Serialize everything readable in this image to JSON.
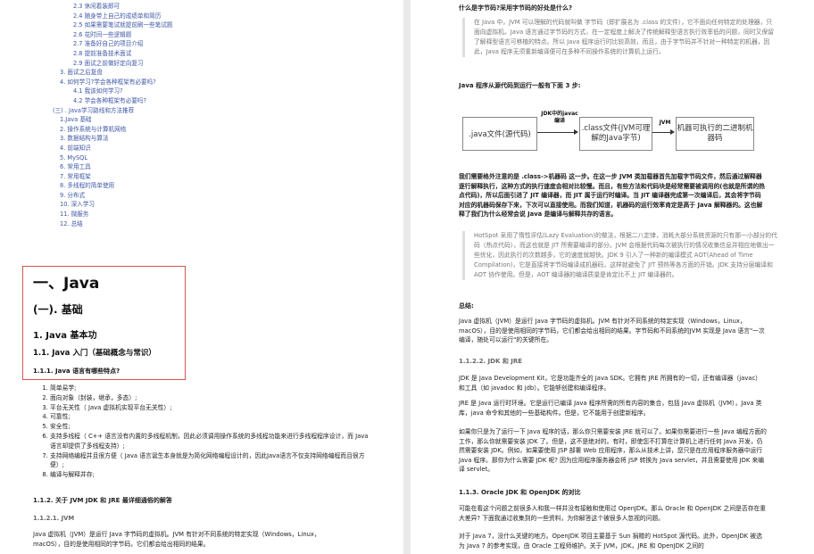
{
  "toc": [
    {
      "level": "l3",
      "text": "2.3 休闲着装即可"
    },
    {
      "level": "l3",
      "text": "2.4 随身带上自己的成绩单和简历"
    },
    {
      "level": "l3",
      "text": "2.5 如果需要笔试就提前刷一些笔试题"
    },
    {
      "level": "l3",
      "text": "2.6 花时间一些逻辑题"
    },
    {
      "level": "l3",
      "text": "2.7 准备好自己的项目介绍"
    },
    {
      "level": "l3",
      "text": "2.8 提前准备技术面试"
    },
    {
      "level": "l3",
      "text": "2.9 面试之前做好定向复习"
    },
    {
      "level": "l2",
      "text": "3. 面试之后复盘"
    },
    {
      "level": "l2",
      "text": "4. 如何学习?学会各种框架有必要吗?"
    },
    {
      "level": "l4",
      "text": "4.1 我该如何学习?"
    },
    {
      "level": "l4",
      "text": "4.2 学会各种框架有必要吗?"
    },
    {
      "level": "l2b",
      "text": "(三) . Java学习路线和方法推荐"
    },
    {
      "level": "l2",
      "text": "1.Java 基础"
    },
    {
      "level": "l2",
      "text": "2. 操作系统与计算机网络"
    },
    {
      "level": "l2",
      "text": "3. 数据结构与算法"
    },
    {
      "level": "l2",
      "text": "4. 前端知识"
    },
    {
      "level": "l2",
      "text": "5. MySQL"
    },
    {
      "level": "l2",
      "text": "6. 常用工具"
    },
    {
      "level": "l2",
      "text": "7. 常用框架"
    },
    {
      "level": "l2",
      "text": "8. 多线程的简单使用"
    },
    {
      "level": "l2",
      "text": "9. 分布式"
    },
    {
      "level": "l2",
      "text": "10. 深入学习"
    },
    {
      "level": "l2",
      "text": "11. 微服务"
    },
    {
      "level": "l2",
      "text": "12. 总结"
    }
  ],
  "left": {
    "h1": "一、Java",
    "h2": "(一). 基础",
    "h3": "1. Java 基本功",
    "h4": "1.1. Java 入门（基础概念与常识）",
    "h5": "1.1.1. Java 语言有哪些特点?",
    "features": [
      "简单易学;",
      "面向对象（封装，继承，多态）;",
      "平台无关性（ Java 虚拟机实现平台无关性）;",
      "可靠性;",
      "安全性;",
      "支持多线程（ C++ 语言没有内置的多线程机制，因此必须调用操作系统的多线程功能来进行多线程程序设计，而 Java 语言却提供了多线程支持）;",
      "支持网络编程并且很方便（ Java 语言诞生本身就是为简化网络编程设计的，因此Java语言不仅支持网络编程而且很方便）;",
      "编译与解释并存;"
    ],
    "sub1": "1.1.2. 关于 JVM JDK 和 JRE 最详细通俗的解答",
    "sub2": "1.1.2.1. JVM",
    "para": "Java 虚拟机（JVM）是运行 Java 字节码的虚拟机。JVM 有针对不同系统的特定实现（Windows，Linux，macOS），目的是使用相同的字节码，它们都会给出相同的结果。"
  },
  "right": {
    "q1": "什么是字节码?采用字节码的好处是什么?",
    "quote1": "在 Java 中，JVM 可以理解的代码就叫做 字节码（即扩展名为 .class 的文件），它不面向任何特定的处理器，只面向虚拟机。Java 语言通过字节码的方式，在一定程度上解决了传统解释型语言执行效率低的问题，同时又保留了解释型语言可移植的特点。所以 Java 程序运行时比较高效，而且，由于字节码并不针对一种特定的机器，因此，Java 程序无须重新编译便可在多种不同操作系统的计算机上运行。",
    "q2": "Java 程序从源代码到运行一般有下面 3 步:",
    "flow": {
      "box1": ".java文件(源代码)",
      "label1": "JDK中的javac编译",
      "box2": ".class文件(JVM可理解的Java字节)",
      "label2": "JVM",
      "box3": "机器可执行的二进制机器码"
    },
    "para1": "我们需要格外注意的是 .class->机器码 这一步。在这一步 JVM 类加载器首先加载字节码文件，然后通过解释器逐行解释执行，这种方式的执行速度会相对比较慢。而且，有些方法和代码块是经常需要被调用的(也就是所谓的热点代码)，所以后面引进了 JIT 编译器，而 JIT 属于运行时编译。当 JIT 编译器完成第一次编译后，其会将字节码对应的机器码保存下来，下次可以直接使用。而我们知道，机器码的运行效率肯定是高于 Java 解释器的。这也解释了我们为什么经常会说 Java 是编译与解释共存的语言。",
    "quote2": "HotSpot 采用了惰性评估(Lazy Evaluation)的做法，根据二八定律，消耗大部分系统资源的只有那一小部分的代码（热点代码），而这也就是 JIT 所需要编译的部分。JVM 会根据代码每次被执行的情况收集信息并相应地做出一些优化，因此执行的次数越多，它的速度就越快。JDK 9 引入了一种新的编译模式 AOT(Ahead of Time Compilation)，它是直接将字节码编译成机器码，这样就避免了 JIT 预热等各方面的开销。JDK 支持分层编译和 AOT 协作使用。但是，AOT 编译器的编译质量是肯定比不上 JIT 编译器的。",
    "summary_title": "总结:",
    "summary": "Java 虚拟机（JVM）是运行 Java 字节码的虚拟机。JVM 有针对不同系统的特定实现（Windows，Linux，macOS），目的是使用相同的字节码，它们都会给出相同的结果。字节码和不同系统的JVM 实现是 Java 语言\"一次编译，随处可以运行\"的关键所在。",
    "h_jdk": "1.1.2.2. JDK 和 JRE",
    "p_jdk": "JDK 是 Java Development Kit，它是功能齐全的 Java SDK。它拥有 JRE 所拥有的一切，还有编译器（javac）和工具（如 javadoc 和 jdb）。它能够创建和编译程序。",
    "p_jre": "JRE 是 Java 运行时环境。它是运行已编译 Java 程序所需的所有内容的集合，包括 Java 虚拟机（JVM），Java 类库，java 命令和其他的一些基础构件。但是，它不能用于创建新程序。",
    "p_more": "如果你只是为了运行一下 Java 程序的话，那么你只需要安装 JRE 就可以了。如果你需要进行一些 Java 编程方面的工作，那么你就需要安装 JDK 了。但是，这不是绝对的。有时，即使您不打算在计算机上进行任何 Java 开发，仍然需要安装 JDK。例如，如果要使用 JSP 部署 Web 应用程序，那么从技术上讲，您只是在应用程序服务器中运行 Java 程序。那你为什么需要 JDK 呢? 因为应用程序服务器会将 JSP 转换为 Java servlet，并且需要使用 JDK 来编译 servlet。",
    "h_oracle": "1.1.3. Oracle JDK 和 OpenJDK 的对比",
    "p_oracle": "可能在看这个问题之前很多人和我一样并没有接触和使用过 OpenJDK。那么 Oracle 和 OpenJDK 之间是否存在重大差异? 下面我通过收集到的一些资料，为你解答这个被很多人忽视的问题。",
    "p_java7": "对于 Java 7，没什么关键的地方。OpenJDK 项目主要基于 Sun 捐赠的 HotSpot 源代码。此外，OpenJDK 被选为 Java 7 的参考实现，由 Oracle 工程师维护。关于 JVM，JDK，JRE 和 OpenJDK 之间的"
  }
}
